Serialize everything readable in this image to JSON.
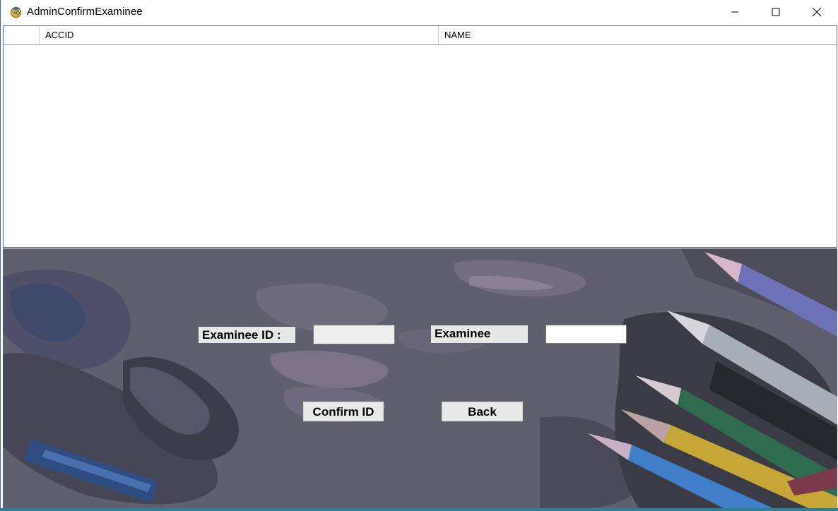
{
  "window": {
    "title": "AdminConfirmExaminee",
    "icon": "app-icon"
  },
  "grid": {
    "columns": [
      "ACCID",
      "NAME"
    ],
    "rows": []
  },
  "form": {
    "examinee_id_label": "Examinee ID :",
    "examinee_id_value": "",
    "examinee_label": "Examinee",
    "examinee_value": "",
    "confirm_button": "Confirm ID",
    "back_button": "Back"
  },
  "colors": {
    "panel_background": "#5e5e6d",
    "label_background": "#e8e8e8"
  }
}
